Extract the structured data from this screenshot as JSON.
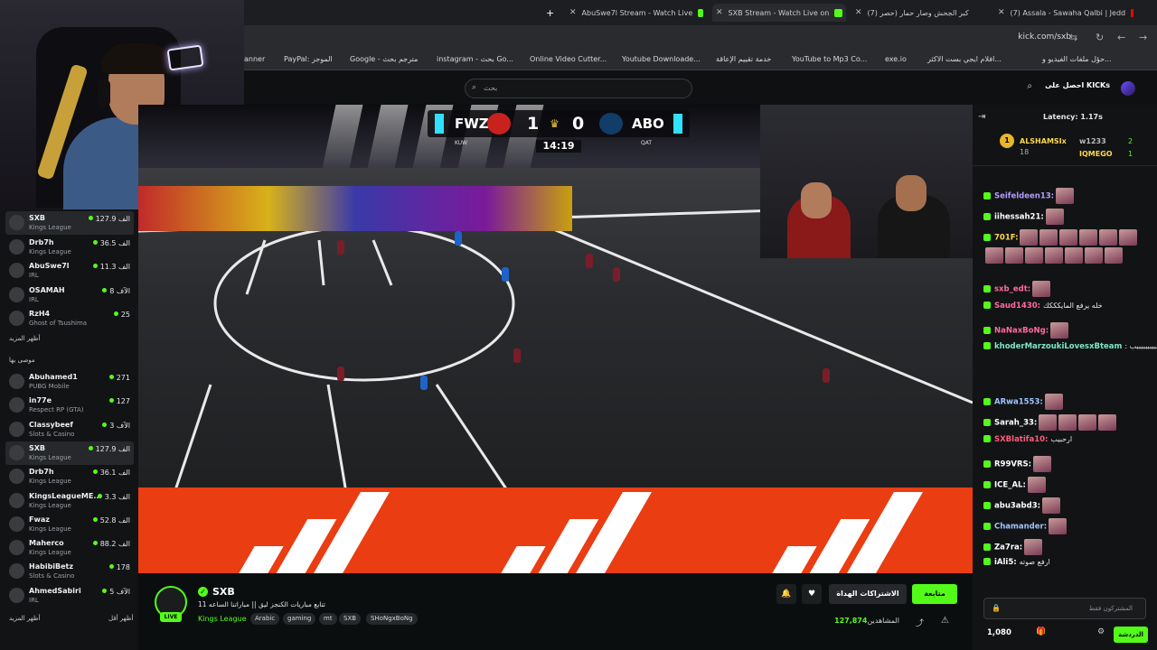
{
  "browser": {
    "tabs": [
      {
        "title": "AbuSwe7l Stream - Watch Live",
        "color": "#53fc18"
      },
      {
        "title": "SXB Stream - Watch Live on",
        "color": "#53fc18"
      },
      {
        "title": "(7) كبر الجحش وصار حمار (حصر",
        "color": "#ff0000"
      },
      {
        "title": "(7) Assala - Sawaha Qalbi | Jedd",
        "color": "#ff0000"
      }
    ],
    "url": "kick.com/sxb",
    "bookmarks": [
      "anner",
      "PayPal: الموجز",
      "Google - مترجم بحث",
      "instagram - بحث Go...",
      "Online Video Cutter...",
      "Youtube Downloade...",
      "خدمة تقييم الإعاقة",
      "YouTube to Mp3 Co...",
      "exe.io",
      "افلام ايجي بست الاكثر...",
      "حؤل ملفات الفيديو و..."
    ]
  },
  "sidebar": {
    "following": [
      {
        "name": "SXB",
        "category": "Kings League",
        "viewers": "127.9 الف",
        "selected": true
      },
      {
        "name": "Drb7h",
        "category": "Kings League",
        "viewers": "36.5 الف"
      },
      {
        "name": "AbuSwe7l",
        "category": "IRL",
        "viewers": "11.3 الف"
      },
      {
        "name": "OSAMAH",
        "category": "IRL",
        "viewers": "8 الآف"
      },
      {
        "name": "RzH4",
        "category": "Ghost of Tsushima",
        "viewers": "25"
      }
    ],
    "show_more": "أظهر المزيد",
    "recommended_header": "موصى بها",
    "recommended": [
      {
        "name": "Abuhamed1",
        "category": "PUBG Mobile",
        "viewers": "271"
      },
      {
        "name": "in77e",
        "category": "Respect RP (GTA)",
        "viewers": "127"
      },
      {
        "name": "Classybeef",
        "category": "Slots & Casino",
        "viewers": "3 الآف"
      },
      {
        "name": "SXB",
        "category": "Kings League",
        "viewers": "127.9 الف",
        "selected": true
      },
      {
        "name": "Drb7h",
        "category": "Kings League",
        "viewers": "36.1 الف"
      },
      {
        "name": "KingsLeagueME...",
        "category": "Kings League",
        "viewers": "3.3 الف"
      },
      {
        "name": "Fwaz",
        "category": "Kings League",
        "viewers": "52.8 الف"
      },
      {
        "name": "Maherco",
        "category": "Kings League",
        "viewers": "88.2 الف"
      },
      {
        "name": "HabibiBetz",
        "category": "Slots & Casino",
        "viewers": "178"
      },
      {
        "name": "AhmedSabiri",
        "category": "IRL",
        "viewers": "5 الآف"
      }
    ],
    "show_more2": "أظهر المزيد",
    "show_less": "أظهر أقل"
  },
  "header": {
    "search_placeholder": "بحث",
    "get_kicks": "احصل على KICKs"
  },
  "scoreboard": {
    "home": "FWZ",
    "home_score": "1",
    "away": "ABO",
    "away_score": "0",
    "clock": "14:19",
    "home_country": "KUW",
    "away_country": "QAT"
  },
  "stream": {
    "name": "SXB",
    "live": "LIVE",
    "title": "تتابع مباريات الكنجز ليق || مباراتنا الساعه 11",
    "category": "Kings League",
    "tags": [
      "Arabic",
      "gaming",
      "mt",
      "SXB",
      "SHoNgxBoNg"
    ],
    "follow": "متابعة",
    "subscribe": "الاشتراكات الهداة",
    "viewers_label": "المشاهدين",
    "viewers": "127,874"
  },
  "chat": {
    "latency": "Latency: 1.17s",
    "leaderboard": [
      {
        "name": "ALSHAMSIx",
        "count": "18"
      },
      {
        "name": "w1233",
        "count": "2"
      },
      {
        "name": "IQMEGO",
        "count": "1"
      }
    ],
    "messages": [
      {
        "user": "Seifeldeen13:",
        "color": "#b39dff",
        "text": "",
        "emotes": 1
      },
      {
        "user": "iihessah21:",
        "color": "#ffffff",
        "text": "",
        "emotes": 1
      },
      {
        "user": "701F:",
        "color": "#ffd84d",
        "text": "",
        "emotes": 13
      },
      {
        "user": "sxb_edt:",
        "color": "#ff6b9e",
        "text": "",
        "emotes": 1
      },
      {
        "user": "Saud1430:",
        "color": "#ff6b9e",
        "text": "خله يرفع المايكككك",
        "emotes": 0
      },
      {
        "user": "NaNaxBoNg:",
        "color": "#ff6b9e",
        "text": "",
        "emotes": 1
      },
      {
        "user": "khoderMarzoukiLovesxBteam",
        "color": "#7ee8c8",
        "text": ": يا ارحبببببببببببب",
        "emotes": 0
      },
      {
        "user": "ARwa1553:",
        "color": "#9ec5ff",
        "text": "",
        "emotes": 1
      },
      {
        "user": "Sarah_33:",
        "color": "#ffffff",
        "text": "",
        "emotes": 4
      },
      {
        "user": "SXBlatifa10:",
        "color": "#ff5c7a",
        "text": "ارحبيب",
        "emotes": 0
      },
      {
        "user": "R99VRS:",
        "color": "#ffffff",
        "text": "",
        "emotes": 1
      },
      {
        "user": "ICE_AL:",
        "color": "#ffffff",
        "text": "",
        "emotes": 1
      },
      {
        "user": "abu3abd3:",
        "color": "#ffffff",
        "text": "",
        "emotes": 1
      },
      {
        "user": "Chamander:",
        "color": "#9ec5ff",
        "text": "",
        "emotes": 1
      },
      {
        "user": "Za7ra:",
        "color": "#ffffff",
        "text": "",
        "emotes": 1
      },
      {
        "user": "iAli5:",
        "color": "#ffffff",
        "text": "ارفع صوته",
        "emotes": 0
      }
    ],
    "input_placeholder": "المشتركون فقط",
    "chat_button": "الدردشة",
    "points": "1,080"
  }
}
